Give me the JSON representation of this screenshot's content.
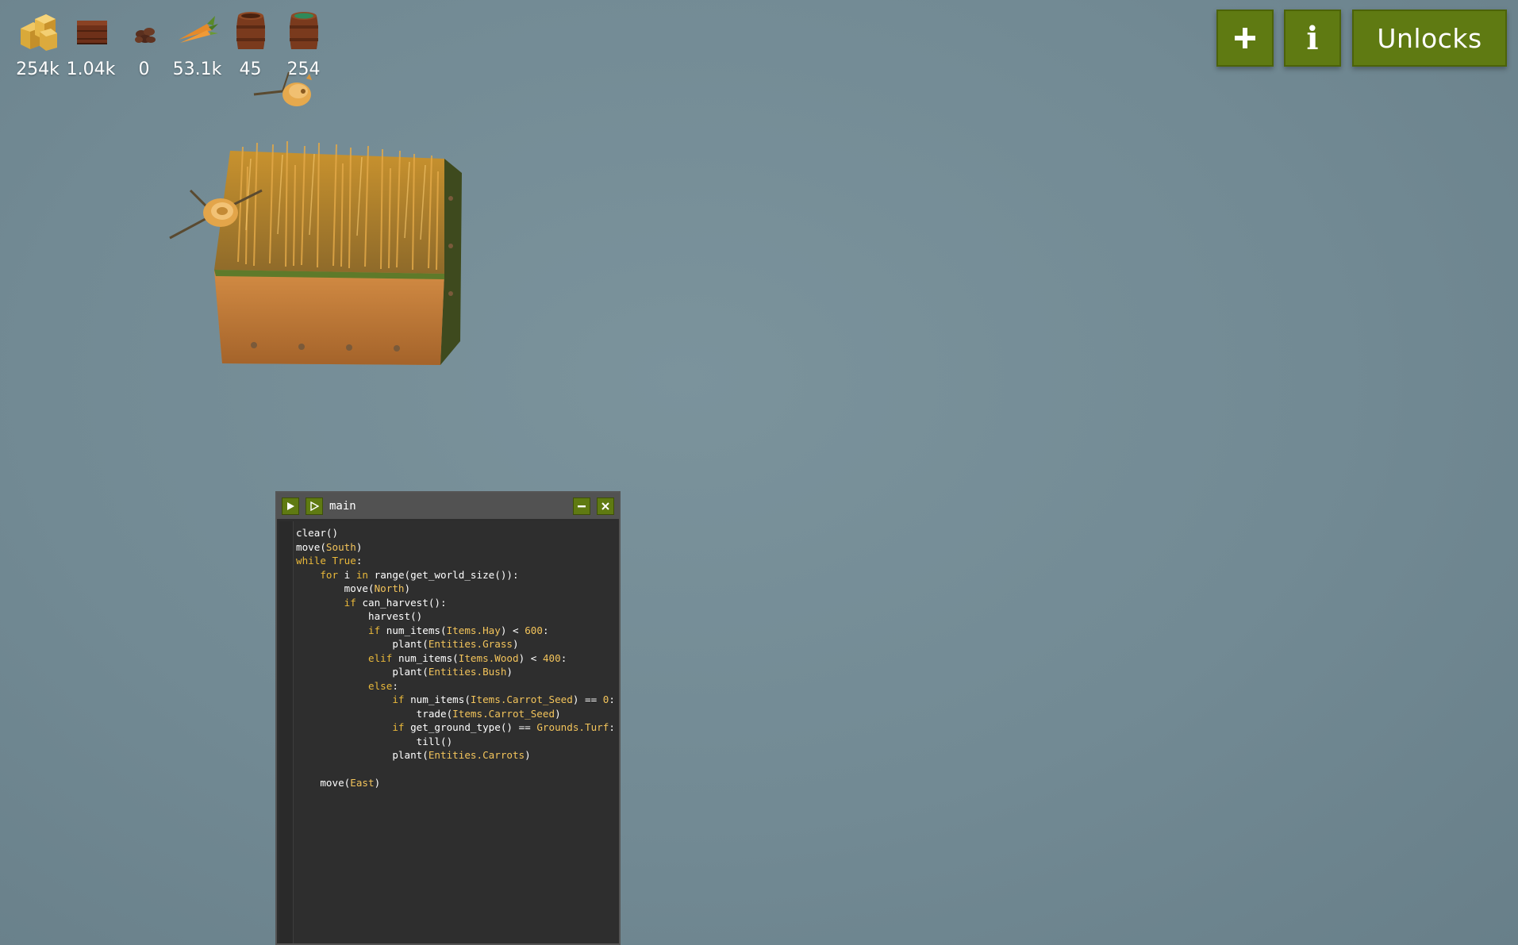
{
  "resources": [
    {
      "icon": "hay-icon",
      "count": "254k"
    },
    {
      "icon": "wood-icon",
      "count": "1.04k"
    },
    {
      "icon": "carrot-seed-icon",
      "count": "0"
    },
    {
      "icon": "carrot-icon",
      "count": "53.1k"
    },
    {
      "icon": "empty-barrel-icon",
      "count": "45"
    },
    {
      "icon": "water-barrel-icon",
      "count": "254"
    }
  ],
  "buttons": {
    "add": "+",
    "info": "i",
    "unlocks": "Unlocks"
  },
  "editor": {
    "title": "main",
    "lines": [
      [
        [
          "fn",
          "clear()"
        ]
      ],
      [
        [
          "fn",
          "move("
        ],
        [
          "name",
          "South"
        ],
        [
          "fn",
          ")"
        ]
      ],
      [
        [
          "kw",
          "while"
        ],
        [
          "op",
          " "
        ],
        [
          "kw",
          "True"
        ],
        [
          "op",
          ":"
        ]
      ],
      [
        [
          "op",
          "    "
        ],
        [
          "kw",
          "for"
        ],
        [
          "op",
          " i "
        ],
        [
          "kw",
          "in"
        ],
        [
          "op",
          " "
        ],
        [
          "fn",
          "range(get_world_size()):"
        ]
      ],
      [
        [
          "op",
          "        "
        ],
        [
          "fn",
          "move("
        ],
        [
          "name",
          "North"
        ],
        [
          "fn",
          ")"
        ]
      ],
      [
        [
          "op",
          "        "
        ],
        [
          "kw",
          "if"
        ],
        [
          "op",
          " "
        ],
        [
          "fn",
          "can_harvest():"
        ]
      ],
      [
        [
          "op",
          "            "
        ],
        [
          "fn",
          "harvest()"
        ]
      ],
      [
        [
          "op",
          "            "
        ],
        [
          "kw",
          "if"
        ],
        [
          "op",
          " "
        ],
        [
          "fn",
          "num_items("
        ],
        [
          "name",
          "Items.Hay"
        ],
        [
          "fn",
          ") < "
        ],
        [
          "num",
          "600"
        ],
        [
          "op",
          ":"
        ]
      ],
      [
        [
          "op",
          "                "
        ],
        [
          "fn",
          "plant("
        ],
        [
          "name",
          "Entities.Grass"
        ],
        [
          "fn",
          ")"
        ]
      ],
      [
        [
          "op",
          "            "
        ],
        [
          "kw",
          "elif"
        ],
        [
          "op",
          " "
        ],
        [
          "fn",
          "num_items("
        ],
        [
          "name",
          "Items.Wood"
        ],
        [
          "fn",
          ") < "
        ],
        [
          "num",
          "400"
        ],
        [
          "op",
          ":"
        ]
      ],
      [
        [
          "op",
          "                "
        ],
        [
          "fn",
          "plant("
        ],
        [
          "name",
          "Entities.Bush"
        ],
        [
          "fn",
          ")"
        ]
      ],
      [
        [
          "op",
          "            "
        ],
        [
          "kw",
          "else"
        ],
        [
          "op",
          ":"
        ]
      ],
      [
        [
          "op",
          "                "
        ],
        [
          "kw",
          "if"
        ],
        [
          "op",
          " "
        ],
        [
          "fn",
          "num_items("
        ],
        [
          "name",
          "Items.Carrot_Seed"
        ],
        [
          "fn",
          ") == "
        ],
        [
          "num",
          "0"
        ],
        [
          "op",
          ":"
        ]
      ],
      [
        [
          "op",
          "                    "
        ],
        [
          "fn",
          "trade("
        ],
        [
          "name",
          "Items.Carrot_Seed"
        ],
        [
          "fn",
          ")"
        ]
      ],
      [
        [
          "op",
          "                "
        ],
        [
          "kw",
          "if"
        ],
        [
          "op",
          " "
        ],
        [
          "fn",
          "get_ground_type() == "
        ],
        [
          "name",
          "Grounds.Turf"
        ],
        [
          "op",
          ":"
        ]
      ],
      [
        [
          "op",
          "                    "
        ],
        [
          "fn",
          "till()"
        ]
      ],
      [
        [
          "op",
          "                "
        ],
        [
          "fn",
          "plant("
        ],
        [
          "name",
          "Entities.Carrots"
        ],
        [
          "fn",
          ")"
        ]
      ],
      [
        [
          "op",
          ""
        ]
      ],
      [
        [
          "op",
          "    "
        ],
        [
          "fn",
          "move("
        ],
        [
          "name",
          "East"
        ],
        [
          "fn",
          ")"
        ]
      ]
    ]
  }
}
